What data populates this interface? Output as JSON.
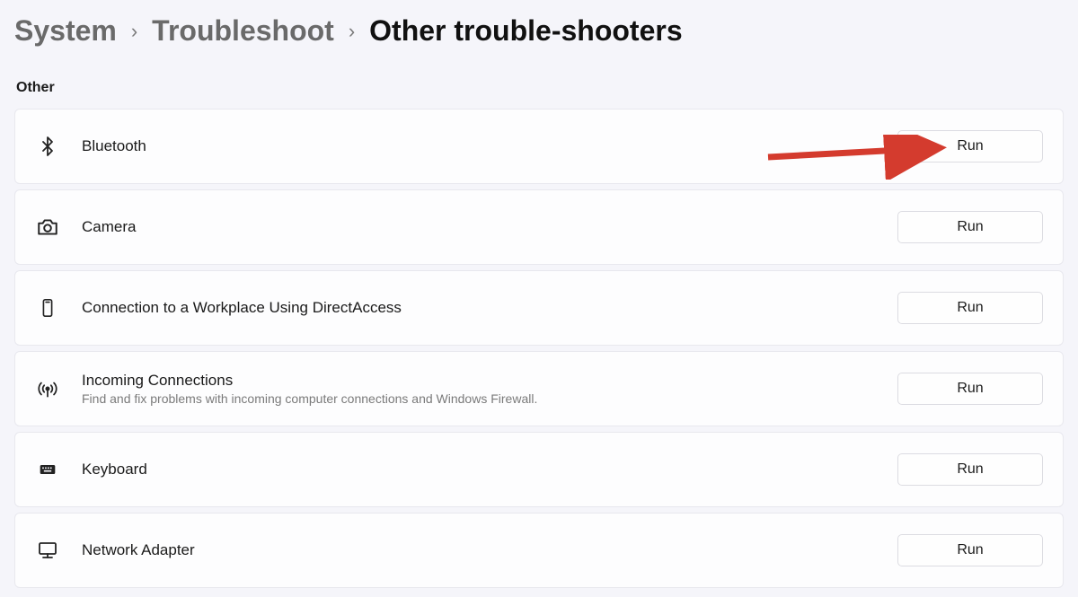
{
  "breadcrumb": {
    "system": "System",
    "troubleshoot": "Troubleshoot",
    "current": "Other trouble-shooters"
  },
  "section_label": "Other",
  "run_label": "Run",
  "items": [
    {
      "id": "bluetooth",
      "title": "Bluetooth",
      "desc": ""
    },
    {
      "id": "camera",
      "title": "Camera",
      "desc": ""
    },
    {
      "id": "directaccess",
      "title": "Connection to a Workplace Using DirectAccess",
      "desc": ""
    },
    {
      "id": "incoming",
      "title": "Incoming Connections",
      "desc": "Find and fix problems with incoming computer connections and Windows Firewall."
    },
    {
      "id": "keyboard",
      "title": "Keyboard",
      "desc": ""
    },
    {
      "id": "network",
      "title": "Network Adapter",
      "desc": ""
    }
  ]
}
